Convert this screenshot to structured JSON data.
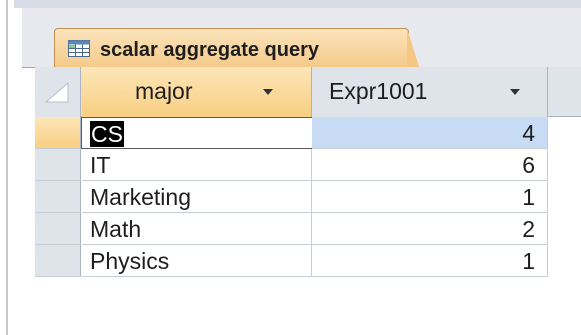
{
  "window": {
    "tab_title": "scalar aggregate query",
    "tab_icon": "query-datasheet-icon"
  },
  "datasheet": {
    "columns": [
      {
        "label": "major"
      },
      {
        "label": "Expr1001"
      }
    ],
    "rows": [
      {
        "major": "CS",
        "expr": "4",
        "current": true
      },
      {
        "major": "IT",
        "expr": "6"
      },
      {
        "major": "Marketing",
        "expr": "1"
      },
      {
        "major": "Math",
        "expr": "2"
      },
      {
        "major": "Physics",
        "expr": "1"
      }
    ]
  },
  "colors": {
    "tab_active": "#f4c784",
    "header_bg": "#dfe3ea",
    "current_row_cell": "#c7dcf4"
  }
}
